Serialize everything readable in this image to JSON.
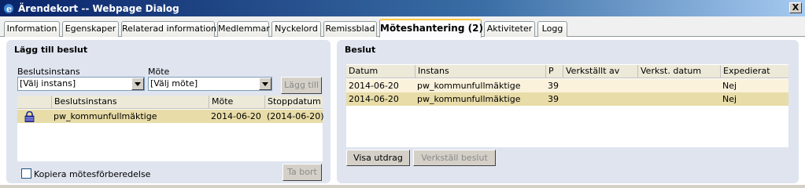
{
  "window": {
    "title": "Ärendekort -- Webpage Dialog",
    "close_label": "X"
  },
  "tabs": [
    {
      "label": "Information"
    },
    {
      "label": "Egenskaper"
    },
    {
      "label": "Relaterad information"
    },
    {
      "label": "Medlemmar"
    },
    {
      "label": "Nyckelord"
    },
    {
      "label": "Remissblad"
    },
    {
      "label": "Möteshantering (2)",
      "active": true
    },
    {
      "label": "Aktiviteter"
    },
    {
      "label": "Logg"
    }
  ],
  "left_panel": {
    "title": "Lägg till beslut",
    "beslutsinstans_label": "Beslutsinstans",
    "beslutsinstans_value": "[Välj instans]",
    "mote_label": "Möte",
    "mote_value": "[Välj möte]",
    "add_button": "Lägg till",
    "grid": {
      "columns": [
        "Beslutsinstans",
        "Möte",
        "Stoppdatum"
      ],
      "rows": [
        {
          "icon": "lock-icon",
          "instans": "pw_kommunfullmäktige",
          "mote": "2014-06-20",
          "stopp": "(2014-06-20)"
        }
      ]
    },
    "copy_checkbox_label": "Kopiera mötesförberedelse",
    "remove_button": "Ta bort"
  },
  "right_panel": {
    "title": "Beslut",
    "grid": {
      "columns": [
        "Datum",
        "Instans",
        "P",
        "Verkställt av",
        "Verkst. datum",
        "Expedierat"
      ],
      "rows": [
        {
          "datum": "2014-06-20",
          "instans": "pw_kommunfullmäktige",
          "p": "39",
          "verkstallt_av": "",
          "verkst_datum": "",
          "expedierat": "Nej"
        },
        {
          "datum": "2014-06-20",
          "instans": "pw_kommunfullmäktige",
          "p": "39",
          "verkstallt_av": "",
          "verkst_datum": "",
          "expedierat": "Nej"
        }
      ]
    },
    "show_button": "Visa utdrag",
    "execute_button": "Verkställ beslut"
  },
  "colors": {
    "selected_row": "#e8dca8",
    "alt_row": "#fbf2dc",
    "panel_bg": "#dfe4ef",
    "active_tab_accent": "#ffc83c"
  }
}
